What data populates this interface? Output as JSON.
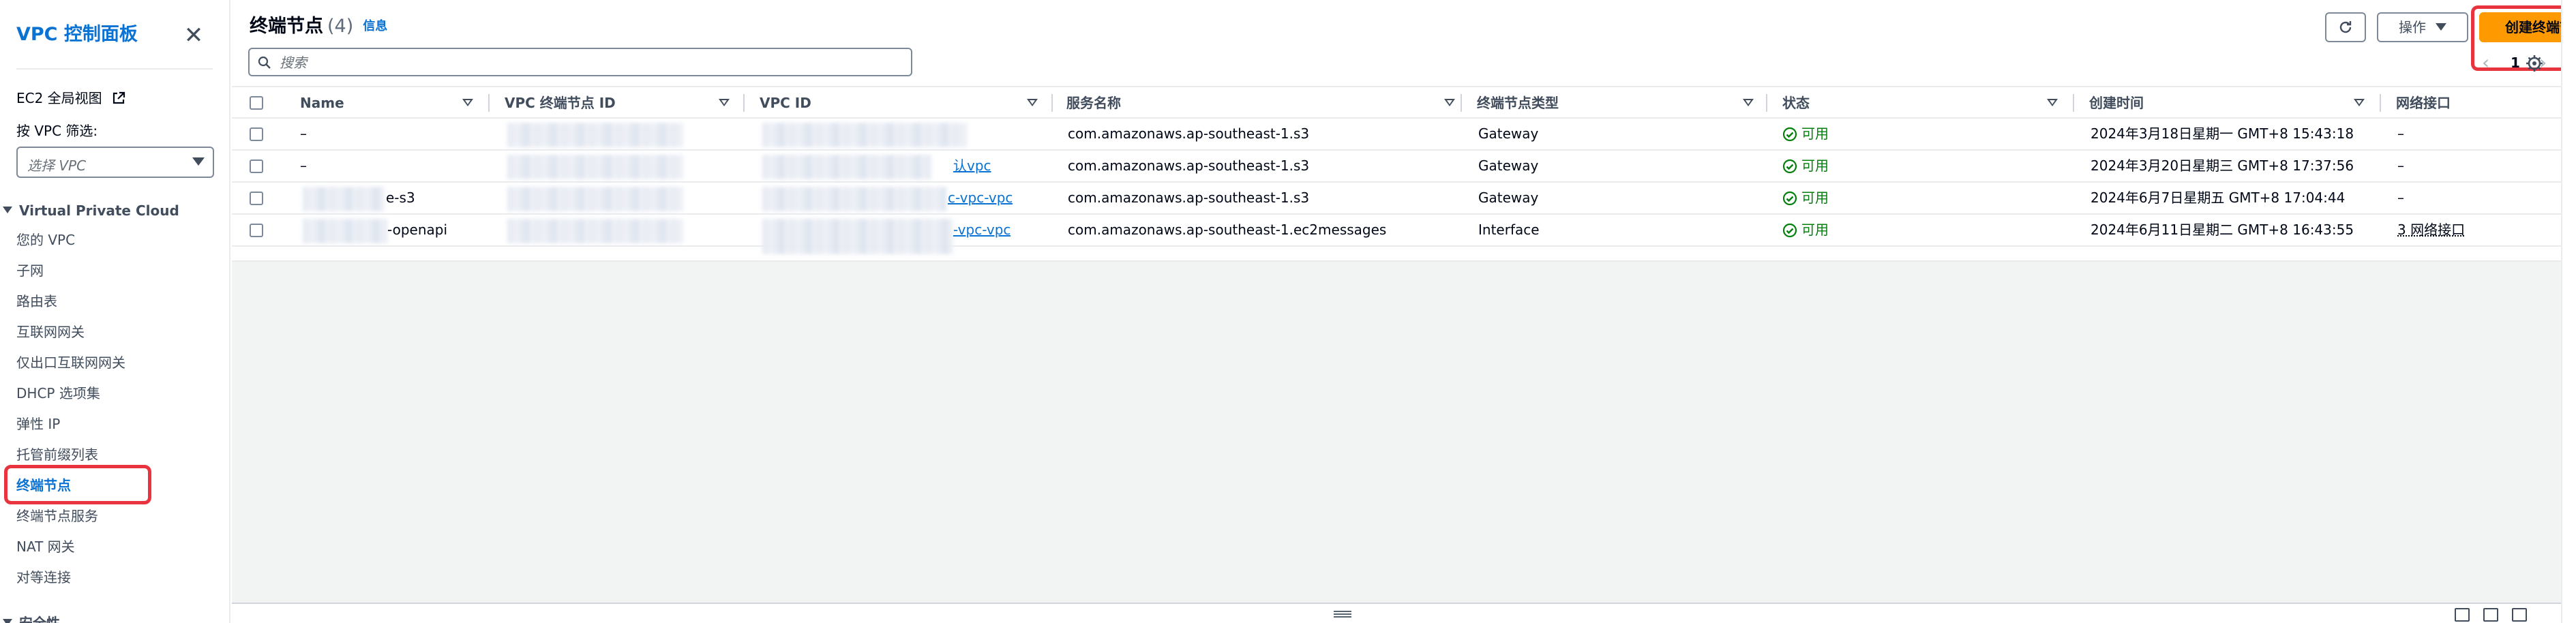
{
  "sidebar": {
    "title": "VPC 控制面板",
    "ec2_global_view": "EC2 全局视图",
    "filter_label": "按 VPC 筛选:",
    "filter_placeholder": "选择 VPC",
    "section": "Virtual Private Cloud",
    "items": [
      {
        "label": "您的 VPC"
      },
      {
        "label": "子网"
      },
      {
        "label": "路由表"
      },
      {
        "label": "互联网网关"
      },
      {
        "label": "仅出口互联网网关"
      },
      {
        "label": "DHCP 选项集"
      },
      {
        "label": "弹性 IP"
      },
      {
        "label": "托管前缀列表"
      },
      {
        "label": "终端节点",
        "active": true
      },
      {
        "label": "终端节点服务"
      },
      {
        "label": "NAT 网关"
      },
      {
        "label": "对等连接"
      }
    ],
    "next_section": "安全性"
  },
  "header": {
    "title": "终端节点",
    "count": "(4)",
    "info": "信息",
    "actions_label": "操作",
    "create_label": "创建终端节点",
    "search_placeholder": "搜索",
    "page_number": "1"
  },
  "table": {
    "columns": [
      "Name",
      "VPC 终端节点 ID",
      "VPC ID",
      "服务名称",
      "终端节点类型",
      "状态",
      "创建时间",
      "网络接口"
    ],
    "rows": [
      {
        "name": "–",
        "vpc_id_suffix": "",
        "service": "com.amazonaws.ap-southeast-1.s3",
        "type": "Gateway",
        "status": "可用",
        "created": "2024年3月18日星期一 GMT+8 15:43:18",
        "eni": "–"
      },
      {
        "name": "–",
        "vpc_id_suffix": "认vpc",
        "service": "com.amazonaws.ap-southeast-1.s3",
        "type": "Gateway",
        "status": "可用",
        "created": "2024年3月20日星期三 GMT+8 17:37:56",
        "eni": "–"
      },
      {
        "name": "e-s3",
        "vpc_id_suffix": "c-vpc-vpc",
        "service": "com.amazonaws.ap-southeast-1.s3",
        "type": "Gateway",
        "status": "可用",
        "created": "2024年6月7日星期五 GMT+8 17:04:44",
        "eni": "–"
      },
      {
        "name": "-openapi",
        "vpc_id_suffix": "-vpc-vpc",
        "service": "com.amazonaws.ap-southeast-1.ec2messages",
        "type": "Interface",
        "status": "可用",
        "created": "2024年6月11日星期二 GMT+8 16:43:55",
        "eni": "3 网络接口"
      }
    ]
  },
  "colors": {
    "accent": "#0972d3",
    "primary_button": "#ff9900",
    "status_ok": "#037f0c",
    "highlight": "#e8343f"
  }
}
